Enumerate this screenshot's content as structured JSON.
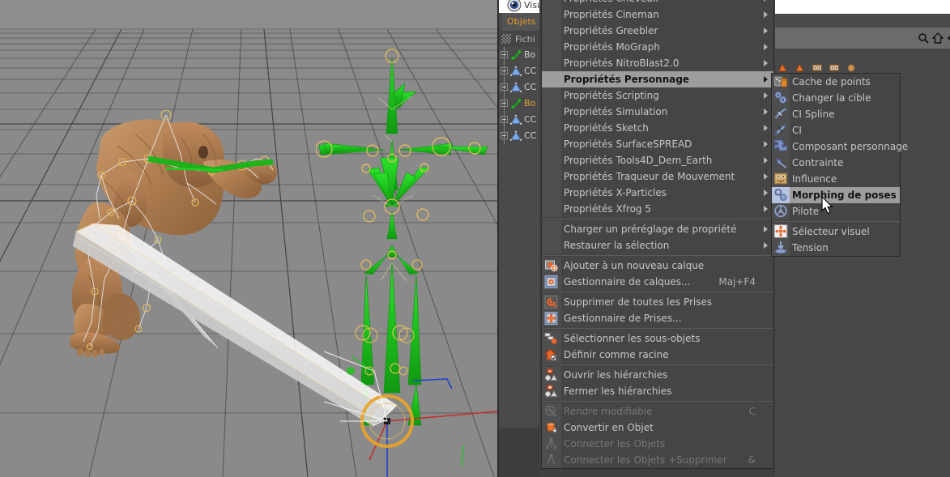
{
  "app": {
    "viewport_name": "3d-viewport",
    "object_manager_top_label": "Visu",
    "object_manager_tab": "Objets",
    "object_manager_menu": "Fichi"
  },
  "object_manager": {
    "rows": [
      {
        "icon": "bone-icon",
        "label": "Bo",
        "selected": false
      },
      {
        "icon": "null-icon",
        "label": "CC",
        "selected": false
      },
      {
        "icon": "null-icon",
        "label": "CC",
        "selected": false
      },
      {
        "icon": "bone-icon",
        "label": "Bo",
        "selected": true
      },
      {
        "icon": "null-icon",
        "label": "CC",
        "selected": false
      },
      {
        "icon": "null-icon",
        "label": "CC",
        "selected": false
      }
    ]
  },
  "right_panel": {
    "search_icons": [
      "magnifier-icon",
      "home-icon",
      "back-arrow-icon"
    ],
    "tags": [
      "triangle-tag-icon",
      "triangle-tag-icon",
      "eyes-tag-icon",
      "eyes-tag-icon",
      "sphere-tag-icon"
    ]
  },
  "context_menu": {
    "name": "object-properties-context-menu",
    "items": [
      {
        "label": "Propriétés Cheveux",
        "submenu": true,
        "icon": null,
        "shortcut": null,
        "highlighted": false,
        "disabled": false
      },
      {
        "label": "Propriétés Cineman",
        "submenu": true,
        "icon": null,
        "shortcut": null,
        "highlighted": false,
        "disabled": false
      },
      {
        "label": "Propriétés Greebler",
        "submenu": true,
        "icon": null,
        "shortcut": null,
        "highlighted": false,
        "disabled": false
      },
      {
        "label": "Propriétés MoGraph",
        "submenu": true,
        "icon": null,
        "shortcut": null,
        "highlighted": false,
        "disabled": false
      },
      {
        "label": "Propriétés NitroBlast2.0",
        "submenu": true,
        "icon": null,
        "shortcut": null,
        "highlighted": false,
        "disabled": false
      },
      {
        "label": "Propriétés Personnage",
        "submenu": true,
        "icon": null,
        "shortcut": null,
        "highlighted": true,
        "disabled": false
      },
      {
        "label": "Propriétés Scripting",
        "submenu": true,
        "icon": null,
        "shortcut": null,
        "highlighted": false,
        "disabled": false
      },
      {
        "label": "Propriétés Simulation",
        "submenu": true,
        "icon": null,
        "shortcut": null,
        "highlighted": false,
        "disabled": false
      },
      {
        "label": "Propriétés Sketch",
        "submenu": true,
        "icon": null,
        "shortcut": null,
        "highlighted": false,
        "disabled": false
      },
      {
        "label": "Propriétés SurfaceSPREAD",
        "submenu": true,
        "icon": null,
        "shortcut": null,
        "highlighted": false,
        "disabled": false
      },
      {
        "label": "Propriétés Tools4D_Dem_Earth",
        "submenu": true,
        "icon": null,
        "shortcut": null,
        "highlighted": false,
        "disabled": false
      },
      {
        "label": "Propriétés Traqueur de Mouvement",
        "submenu": true,
        "icon": null,
        "shortcut": null,
        "highlighted": false,
        "disabled": false
      },
      {
        "label": "Propriétés X-Particles",
        "submenu": true,
        "icon": null,
        "shortcut": null,
        "highlighted": false,
        "disabled": false
      },
      {
        "label": "Propriétés Xfrog 5",
        "submenu": true,
        "icon": null,
        "shortcut": null,
        "highlighted": false,
        "disabled": false
      },
      {
        "separator": true
      },
      {
        "label": "Charger un préréglage de propriété",
        "submenu": true,
        "icon": null,
        "shortcut": null,
        "highlighted": false,
        "disabled": false
      },
      {
        "label": "Restaurer la sélection",
        "submenu": true,
        "icon": null,
        "shortcut": null,
        "highlighted": false,
        "disabled": false
      },
      {
        "separator": true
      },
      {
        "label": "Ajouter à un nouveau calque",
        "submenu": false,
        "icon": "layer-add-icon",
        "shortcut": null,
        "highlighted": false,
        "disabled": false
      },
      {
        "label": "Gestionnaire de calques...",
        "submenu": false,
        "icon": "layer-manager-icon",
        "shortcut": "Maj+F4",
        "highlighted": false,
        "disabled": false
      },
      {
        "separator": true
      },
      {
        "label": "Supprimer de toutes les Prises",
        "submenu": false,
        "icon": "take-remove-icon",
        "shortcut": null,
        "highlighted": false,
        "disabled": false
      },
      {
        "label": "Gestionnaire de Prises...",
        "submenu": false,
        "icon": "take-manager-icon",
        "shortcut": null,
        "highlighted": false,
        "disabled": false
      },
      {
        "separator": true
      },
      {
        "label": "Sélectionner les sous-objets",
        "submenu": false,
        "icon": "select-children-icon",
        "shortcut": null,
        "highlighted": false,
        "disabled": false
      },
      {
        "label": "Définir comme racine",
        "submenu": false,
        "icon": "set-root-icon",
        "shortcut": null,
        "highlighted": false,
        "disabled": false
      },
      {
        "separator": true
      },
      {
        "label": "Ouvrir les hiérarchies",
        "submenu": false,
        "icon": "expand-hierarchy-icon",
        "shortcut": null,
        "highlighted": false,
        "disabled": false
      },
      {
        "label": "Fermer les hiérarchies",
        "submenu": false,
        "icon": "collapse-hierarchy-icon",
        "shortcut": null,
        "highlighted": false,
        "disabled": false
      },
      {
        "separator": true
      },
      {
        "label": "Rendre modifiable",
        "submenu": false,
        "icon": "make-editable-icon",
        "shortcut": "C",
        "highlighted": false,
        "disabled": true
      },
      {
        "label": "Convertir en Objet",
        "submenu": false,
        "icon": "convert-object-icon",
        "shortcut": null,
        "highlighted": false,
        "disabled": false
      },
      {
        "label": "Connecter les Objets",
        "submenu": false,
        "icon": "connect-objects-icon",
        "shortcut": null,
        "highlighted": false,
        "disabled": true
      },
      {
        "label": "Connecter les Objets +Supprimer",
        "submenu": false,
        "icon": "connect-delete-icon",
        "shortcut": "&",
        "highlighted": false,
        "disabled": true
      }
    ]
  },
  "submenu": {
    "name": "character-properties-submenu",
    "items": [
      {
        "label": "Cache de points",
        "icon": "point-cache-icon",
        "highlighted": false
      },
      {
        "label": "Changer la cible",
        "icon": "change-target-icon",
        "highlighted": false
      },
      {
        "label": "CI Spline",
        "icon": "ik-spline-icon",
        "highlighted": false
      },
      {
        "label": "CI",
        "icon": "ik-icon",
        "highlighted": false
      },
      {
        "label": "Composant personnage",
        "icon": "character-component-icon",
        "highlighted": false
      },
      {
        "label": "Contrainte",
        "icon": "constraint-icon",
        "highlighted": false
      },
      {
        "label": "Influence",
        "icon": "influence-icon",
        "highlighted": false
      },
      {
        "label": "Morphing de poses",
        "icon": "pose-morph-icon",
        "highlighted": true
      },
      {
        "label": "Pilote",
        "icon": "driver-icon",
        "highlighted": false
      },
      {
        "separator": true
      },
      {
        "label": "Sélecteur visuel",
        "icon": "visual-selector-icon",
        "highlighted": false
      },
      {
        "label": "Tension",
        "icon": "tension-icon",
        "highlighted": false
      }
    ]
  },
  "colors": {
    "menu_bg": "#454545",
    "menu_gutter": "#4e4e4e",
    "highlight": "#9d9d9d",
    "accent_orange": "#e59a2a",
    "rig_green": "#19b319",
    "viewport_bg": "#8a8a8a",
    "skin": "#b4enable"
  }
}
